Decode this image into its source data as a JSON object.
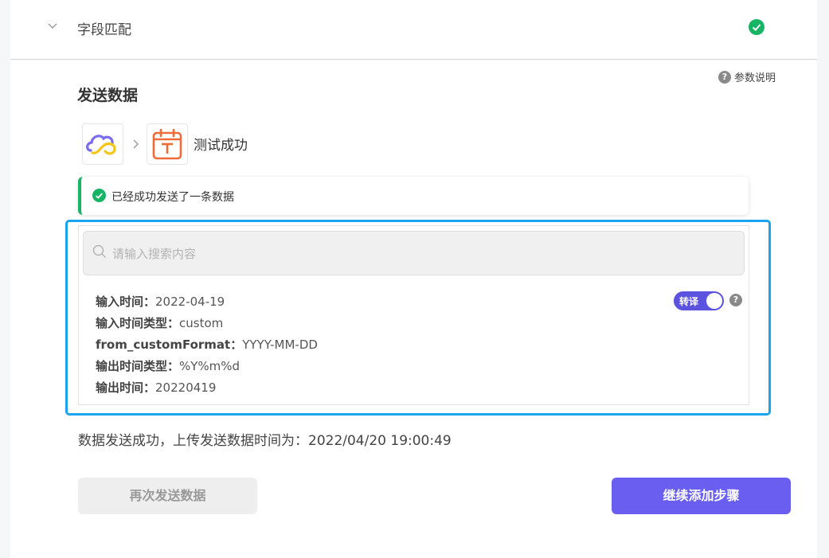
{
  "section": {
    "title": "字段匹配"
  },
  "help": {
    "param_label": "参数说明"
  },
  "send": {
    "title": "发送数据",
    "test_status": "测试成功",
    "alert_message": "已经成功发送了一条数据"
  },
  "search": {
    "placeholder": "请输入搜索内容",
    "value": ""
  },
  "fields": [
    {
      "key": "输入时间：",
      "value": "2022-04-19"
    },
    {
      "key": "输入时间类型：",
      "value": "custom"
    },
    {
      "key": "from_customFormat：",
      "value": "YYYY-MM-DD"
    },
    {
      "key": "输出时间类型：",
      "value": "%Y%m%d"
    },
    {
      "key": "输出时间：",
      "value": "20220419"
    }
  ],
  "toggle": {
    "label": "转译",
    "on": true
  },
  "footer": {
    "message": "数据发送成功，上传发送数据时间为：2022/04/20 19:00:49"
  },
  "buttons": {
    "resend": "再次发送数据",
    "continue": "继续添加步骤"
  },
  "icons": {
    "chevron": "chevron-down-icon",
    "status": "check-circle-icon",
    "help": "question-circle-icon",
    "search": "search-icon",
    "source_app": "cloud-app-icon",
    "target_app": "calendar-app-icon",
    "arrow": "chevron-right-icon"
  },
  "colors": {
    "success": "#18b466",
    "highlight": "#1aa3ee",
    "primary": "#6a5ef0",
    "toggle": "#5b52e0"
  }
}
